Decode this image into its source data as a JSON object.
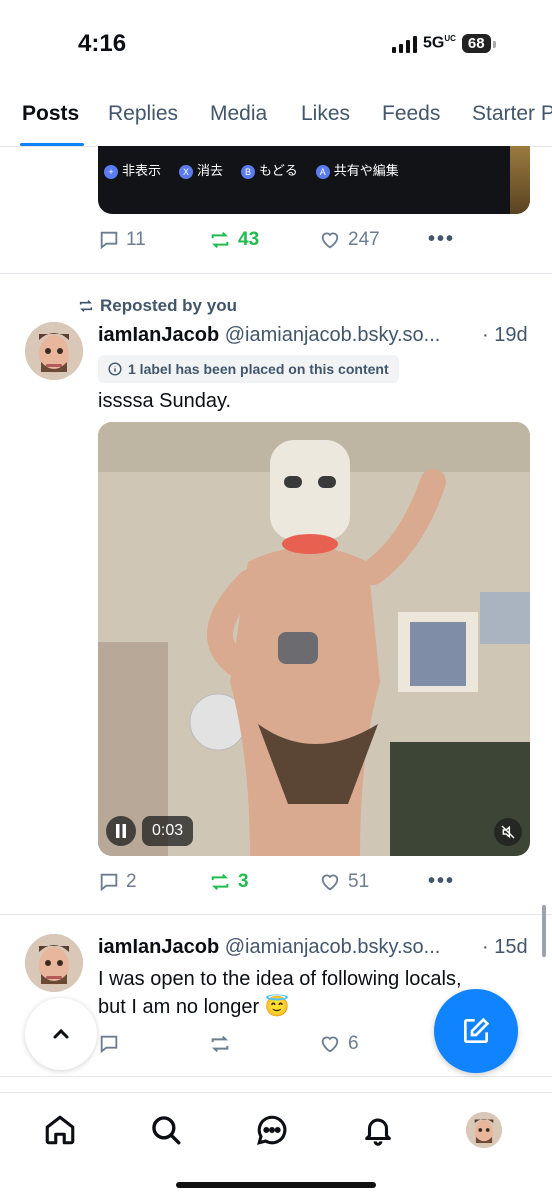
{
  "status": {
    "time": "4:16",
    "network": "5G",
    "network_sub": "UC",
    "battery": "68"
  },
  "tabs": [
    {
      "label": "Posts",
      "active": true
    },
    {
      "label": "Replies"
    },
    {
      "label": "Media"
    },
    {
      "label": "Likes"
    },
    {
      "label": "Feeds"
    },
    {
      "label": "Starter Packs"
    }
  ],
  "top_media": {
    "overlay_items": [
      "非表示",
      "消去",
      "もどる",
      "共有や編集"
    ],
    "overlay_keys": [
      "+",
      "X",
      "B",
      "A"
    ]
  },
  "post1_actions": {
    "replies": "11",
    "reposts": "43",
    "likes": "247"
  },
  "post2": {
    "repost_note": "Reposted by you",
    "author_name": "iamIanJacob",
    "handle": "@iamianjacob.bsky.so...",
    "age": "· 19d",
    "label_notice": "1 label has been placed on this content",
    "text": "issssa Sunday.",
    "video_time": "0:03",
    "replies": "2",
    "reposts": "3",
    "likes": "51"
  },
  "post3": {
    "author_name": "iamIanJacob",
    "handle": "@iamianjacob.bsky.so...",
    "age": "· 15d",
    "text_line1": "I was open to the idea of following locals,",
    "text_line2": "but I am no longer 😇",
    "likes": "6"
  },
  "colors": {
    "accent": "#1083fe",
    "repost_green": "#20bc4f",
    "muted": "#42566b"
  },
  "icons": [
    "home-icon",
    "search-icon",
    "chat-icon",
    "bell-icon",
    "compose-icon",
    "chevron-up-icon"
  ]
}
